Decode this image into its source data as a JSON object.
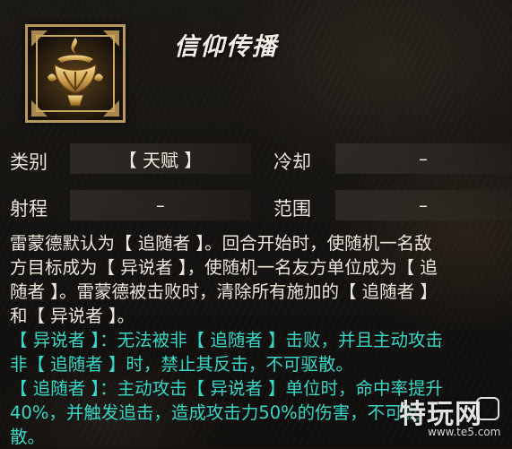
{
  "skill": {
    "title": "信仰传播",
    "icon": "faith-spread-emblem-icon"
  },
  "stats": {
    "category_label": "类别",
    "category_value": "【 天赋 】",
    "cooldown_label": "冷却",
    "cooldown_value": "–",
    "range_label": "射程",
    "range_value": "–",
    "area_label": "范围",
    "area_value": "–"
  },
  "description": {
    "lines": [
      "雷蒙德默认为【 追随者 】。回合开始时，使随机一名敌",
      "方目标成为【 异说者 】，使随机一名友方单位成为【 追",
      "随者 】。雷蒙德被击败时，清除所有施加的【 追随者 】",
      "和【 异说者 】。",
      "【 异说者 】：无法被非【 追随者 】击败，并且主动攻击",
      "非【 追随者 】时，禁止其反击，不可驱散。",
      "【 追随者 】：主动攻击【 异说者 】单位时，命中率提升",
      "40%，并触发追击，造成攻击力50%的伤害，不可驱",
      "散。"
    ]
  },
  "watermark": {
    "text": "特玩网",
    "url": "www.te5.com"
  },
  "colors": {
    "keyword_cyan": "#39d7c8",
    "text": "#ece6dc",
    "frame_gold": "#b99a5c"
  }
}
